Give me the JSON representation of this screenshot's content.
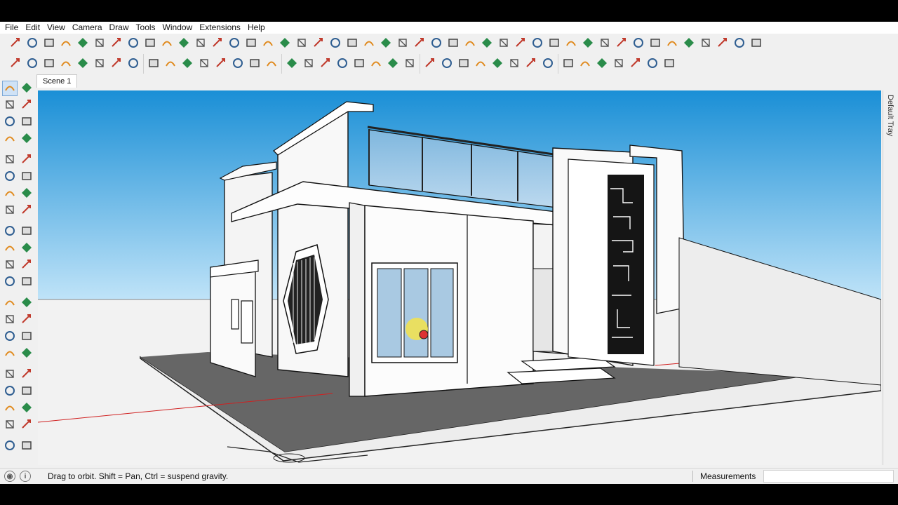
{
  "menu": [
    "File",
    "Edit",
    "View",
    "Camera",
    "Draw",
    "Tools",
    "Window",
    "Extensions",
    "Help"
  ],
  "scene_tabs": [
    "Scene 1"
  ],
  "tray": {
    "label": "Default Tray"
  },
  "status": {
    "hint": "Drag to orbit. Shift = Pan, Ctrl = suspend gravity.",
    "measurements_label": "Measurements",
    "measurements_value": ""
  },
  "toolbar_row1_icons": [
    "move-icon",
    "arc-icon",
    "paint-icon",
    "line-icon",
    "rotate-icon",
    "offset-icon",
    "pushpull-icon",
    "scale-icon",
    "followme-icon",
    "tape-icon",
    "protractor-icon",
    "axes-icon",
    "dimension-icon",
    "text-icon",
    "section-icon",
    "orbit-icon",
    "pan-icon",
    "zoom-icon",
    "zoom-window-icon",
    "zoom-extents-icon",
    "previous-icon",
    "next-icon",
    "position-camera-icon",
    "walk-icon",
    "look-around-icon",
    "sandbox-icon",
    "smoove-icon",
    "stamp-icon",
    "drape-icon",
    "add-detail-icon",
    "flip-edge-icon",
    "grid-icon",
    "contour-icon",
    "shade-icon",
    "xray-icon",
    "wireframe-icon",
    "hidden-line-icon",
    "monochrome-icon",
    "shaded-icon",
    "textured-icon",
    "style-icon",
    "fog-icon",
    "shadow-icon",
    "match-photo-icon",
    "warehouse-icon"
  ],
  "toolbar_row2_icons": [
    "solid-union-icon",
    "solid-subtract-icon",
    "outer-shell-icon",
    "intersect-icon",
    "trim-icon",
    "split-icon",
    "reload-icon",
    "layers-icon",
    "layer-manager-icon",
    "section-plane-icon",
    "display-section-icon",
    "section-cuts-icon",
    "component-icon",
    "group-icon",
    "make-unique-icon",
    "lock-icon",
    "iso-view-icon",
    "top-view-icon",
    "front-view-icon",
    "right-view-icon",
    "back-view-icon",
    "left-view-icon",
    "bottom-view-icon",
    "xray-mode-icon",
    "back-edges-icon",
    "wireframe-mode-icon",
    "hidden-mode-icon",
    "shaded-mode-icon",
    "textured-mode-icon",
    "mono-mode-icon",
    "components-window-icon",
    "materials-window-icon",
    "solar-north-icon",
    "sun-icon",
    "measure-angle-icon",
    "profile-icon",
    "lightbulb-icon",
    "dome-icon",
    "sphere-icon"
  ],
  "left_tools": [
    "select-icon",
    "orbit-tool-icon",
    "paint-bucket-icon",
    "eraser-icon",
    "tape-tool-icon",
    "pencil-tool-icon",
    "line-tool-icon",
    "freehand-icon",
    "rectangle-icon",
    "rotated-rect-icon",
    "circle-icon",
    "polygon-icon",
    "arc-tool-icon",
    "pie-icon",
    "two-point-arc-icon",
    "three-point-arc-icon",
    "move-tool-icon",
    "push-pull-tool-icon",
    "rotate-tool-icon",
    "follow-me-tool-icon",
    "scale-tool-icon",
    "offset-tool-icon",
    "tape-measure-icon",
    "dimension-tool-icon",
    "protractor-tool-icon",
    "text-tool-icon",
    "axes-tool-icon",
    "3d-text-icon",
    "orbit-nav-icon",
    "pan-nav-icon",
    "zoom-nav-icon",
    "zoom-window-nav-icon",
    "zoom-extents-nav-icon",
    "zoom-all-icon",
    "position-camera-nav-icon",
    "look-around-nav-icon",
    "walk-nav-icon",
    "section-plane-nav-icon",
    "sandbox-from-contours-icon",
    "sandbox-from-scratch-icon",
    "smoove-tool-icon",
    "stamp-tool-icon"
  ],
  "colors": {
    "sky_top": "#1a8fd6",
    "sky_bottom": "#b6def6",
    "ground": "#f2f2f2",
    "slab": "#6b6b6b",
    "glass": "#a8cce8",
    "red_axis": "#d02020"
  }
}
